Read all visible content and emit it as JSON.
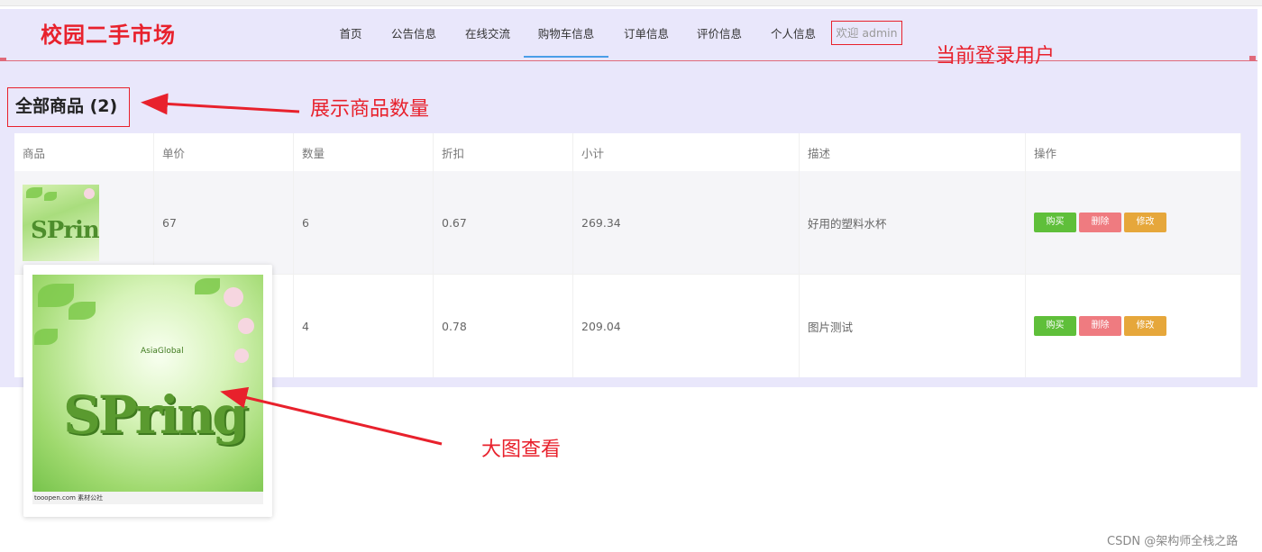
{
  "header": {
    "brand": "校园二手市场",
    "nav": [
      {
        "label": "首页"
      },
      {
        "label": "公告信息"
      },
      {
        "label": "在线交流"
      },
      {
        "label": "购物车信息"
      },
      {
        "label": "订单信息"
      },
      {
        "label": "评价信息"
      },
      {
        "label": "个人信息"
      }
    ],
    "active_tab": "购物车信息",
    "welcome": "欢迎 admin"
  },
  "section": {
    "title": "全部商品 (2)"
  },
  "annotations": {
    "login_user": "当前登录用户",
    "product_count": "展示商品数量",
    "big_image": "大图查看"
  },
  "table": {
    "headers": [
      "商品",
      "单价",
      "数量",
      "折扣",
      "小计",
      "描述",
      "操作"
    ],
    "rows": [
      {
        "image_text": "SPring",
        "price": "67",
        "qty": "6",
        "discount": "0.67",
        "subtotal": "269.34",
        "desc": "好用的塑料水杯"
      },
      {
        "image_text": "SPring",
        "price": "",
        "qty": "4",
        "discount": "0.78",
        "subtotal": "209.04",
        "desc": "图片测试"
      }
    ],
    "actions": {
      "buy": "购买",
      "delete": "删除",
      "edit": "修改"
    }
  },
  "preview": {
    "image_text": "SPring",
    "brandmark": "AsiaGlobal",
    "footer": "tooopen.com 素材公社"
  },
  "colors": {
    "panel_bg": "#e9e7fb",
    "annotation_red": "#e8212c",
    "buy": "#5fbf3a",
    "delete": "#ef7b80",
    "edit": "#e6a73b",
    "active_tab_underline": "#4a9ee8"
  },
  "watermark": "CSDN @架构师全栈之路"
}
